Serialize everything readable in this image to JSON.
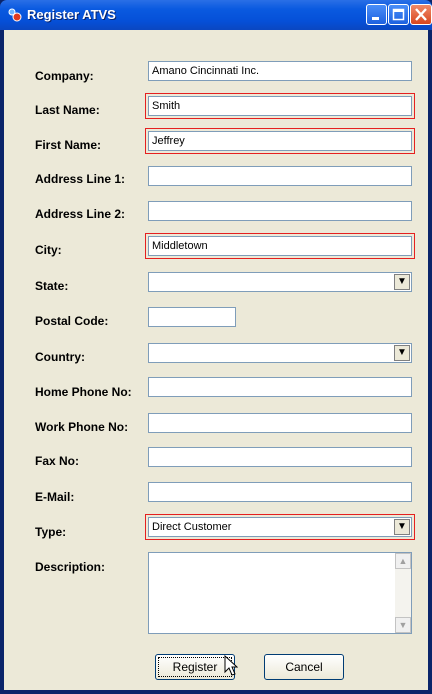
{
  "window": {
    "title": "Register ATVS",
    "icon": "app-icon",
    "controls": [
      "minimize-icon",
      "maximize-icon",
      "close-icon"
    ]
  },
  "form": {
    "company": {
      "label": "Company:",
      "value": "Amano Cincinnati Inc."
    },
    "last_name": {
      "label": "Last Name:",
      "value": "Smith"
    },
    "first_name": {
      "label": "First Name:",
      "value": "Jeffrey"
    },
    "address1": {
      "label": "Address Line 1:",
      "value": ""
    },
    "address2": {
      "label": "Address Line 2:",
      "value": ""
    },
    "city": {
      "label": "City:",
      "value": "Middletown"
    },
    "state": {
      "label": "State:",
      "value": ""
    },
    "postal_code": {
      "label": "Postal Code:",
      "value": ""
    },
    "country": {
      "label": "Country:",
      "value": ""
    },
    "home_phone": {
      "label": "Home Phone No:",
      "value": ""
    },
    "work_phone": {
      "label": "Work Phone No:",
      "value": ""
    },
    "fax": {
      "label": "Fax No:",
      "value": ""
    },
    "email": {
      "label": "E-Mail:",
      "value": ""
    },
    "type": {
      "label": "Type:",
      "value": "Direct Customer"
    },
    "description": {
      "label": "Description:",
      "value": ""
    }
  },
  "buttons": {
    "register": "Register",
    "cancel": "Cancel"
  },
  "colors": {
    "required_outline": "#e52020",
    "window_bg": "#ece9d8",
    "titlebar": "#0a5ae0"
  }
}
